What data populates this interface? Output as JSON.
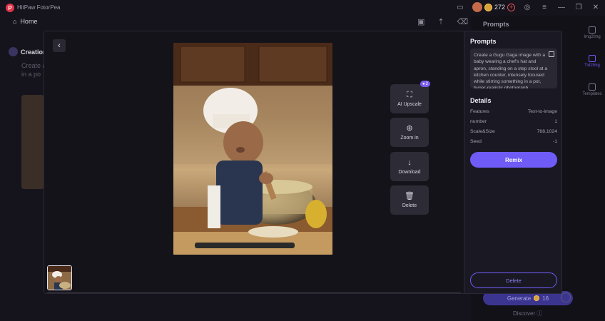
{
  "app": {
    "title": "HitPaw FotorPea",
    "credits": "272"
  },
  "nav": {
    "home_label": "Home"
  },
  "background": {
    "section_title": "Creation",
    "desc_line1": "Create a",
    "desc_line2": "in a po",
    "right_title": "Prompts",
    "side_items": [
      "Img2Img",
      "Txt2Img",
      "Templates"
    ],
    "generate_label": "Generate",
    "generate_cost": "16",
    "discover_label": "Discover"
  },
  "viewer": {
    "tools": [
      {
        "label": "AI Upscale",
        "icon": "upscale-icon",
        "glyph": "⛶",
        "badge": "2"
      },
      {
        "label": "Zoom in",
        "icon": "zoom-in-icon",
        "glyph": "⊕"
      },
      {
        "label": "Download",
        "icon": "download-icon",
        "glyph": "↓"
      },
      {
        "label": "Delete",
        "icon": "trash-icon",
        "glyph": "🗑"
      }
    ]
  },
  "panel": {
    "prompts_title": "Prompts",
    "prompt_text": "Create a Gugu Gaga image with a baby wearing a chef's hat and apron, standing on a step stool at a kitchen counter, intensely focused while stirring something in a pot, hyper-realistic photograph",
    "details_title": "Details",
    "details": [
      {
        "key": "Features",
        "value": "Text-to-image"
      },
      {
        "key": "number",
        "value": "1"
      },
      {
        "key": "Scale&Size",
        "value": "768,1024"
      },
      {
        "key": "Seed",
        "value": "-1"
      }
    ],
    "remix_label": "Remix",
    "delete_label": "Delete"
  }
}
